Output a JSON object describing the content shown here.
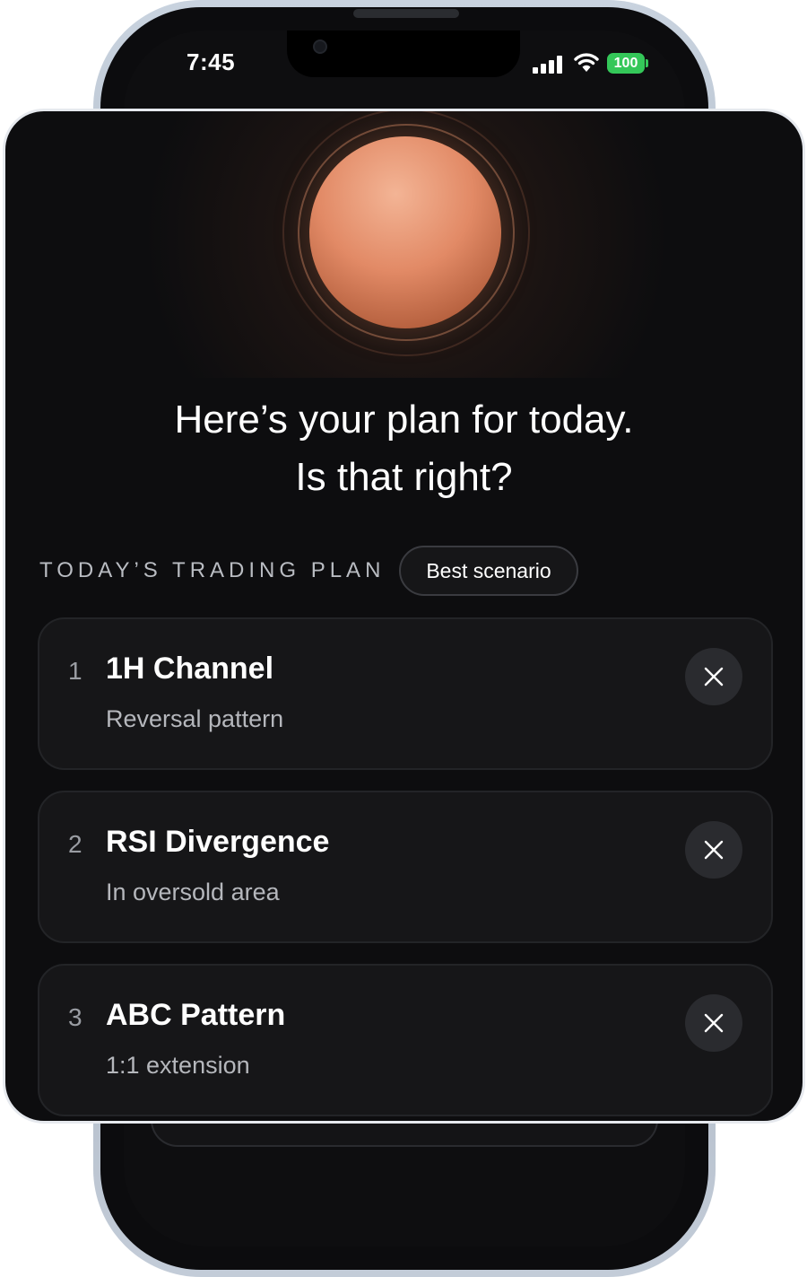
{
  "status_bar": {
    "time": "7:45",
    "battery": "100"
  },
  "hero": {
    "orb_icon": "assistant-orb",
    "accent_color": "#e28a66"
  },
  "headline": {
    "line1": "Here’s your plan for today.",
    "line2": "Is that right?"
  },
  "section": {
    "label": "TODAY’S TRADING PLAN",
    "chip": "Best scenario"
  },
  "plan": {
    "items": [
      {
        "number": "1",
        "title": "1H Channel",
        "subtitle": "Reversal pattern",
        "remove_icon": "close-icon"
      },
      {
        "number": "2",
        "title": "RSI Divergence",
        "subtitle": "In oversold area",
        "remove_icon": "close-icon"
      },
      {
        "number": "3",
        "title": "ABC Pattern",
        "subtitle": "1:1 extension",
        "remove_icon": "close-icon"
      }
    ]
  }
}
